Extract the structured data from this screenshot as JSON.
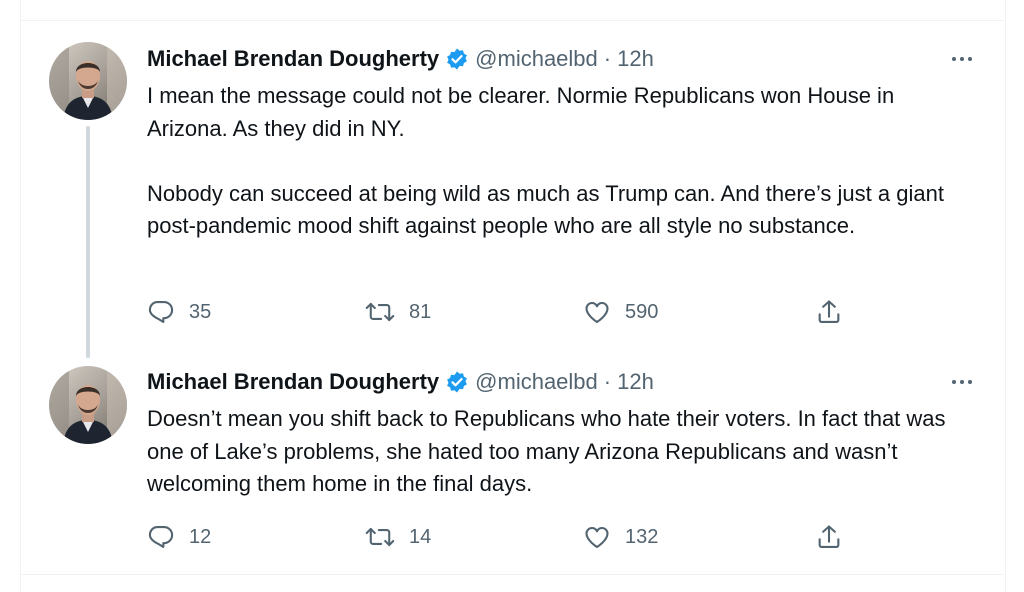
{
  "colors": {
    "text_primary": "#0f1419",
    "text_secondary": "#536471",
    "verified_blue": "#1d9bf0",
    "divider": "#eff3f4",
    "thread_line": "#cfd9de"
  },
  "tweets": [
    {
      "author_name": "Michael Brendan Dougherty",
      "handle": "@michaelbd",
      "separator": "·",
      "time": "12h",
      "verified_icon": "verified-badge-icon",
      "more_icon": "more-options-icon",
      "paragraphs": [
        "I mean the message could not be clearer.  Normie Republicans won House in Arizona. As they did in NY.",
        "Nobody can succeed at being wild as much as Trump can. And there’s just a giant post-pandemic mood shift against people who are all style no substance."
      ],
      "replies": "35",
      "retweets": "81",
      "likes": "590"
    },
    {
      "author_name": "Michael Brendan Dougherty",
      "handle": "@michaelbd",
      "separator": "·",
      "time": "12h",
      "verified_icon": "verified-badge-icon",
      "more_icon": "more-options-icon",
      "paragraphs": [
        "Doesn’t mean you shift back to Republicans who hate their voters. In fact that was one of Lake’s problems, she hated too many Arizona Republicans and wasn’t welcoming them home in the final days."
      ],
      "replies": "12",
      "retweets": "14",
      "likes": "132"
    }
  ],
  "action_icons": [
    "reply-icon",
    "retweet-icon",
    "like-icon",
    "share-icon"
  ]
}
